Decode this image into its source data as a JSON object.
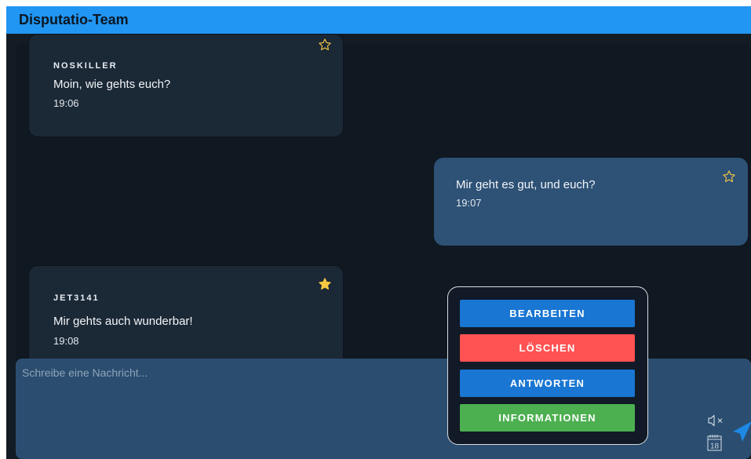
{
  "header": {
    "title": "Disputatio-Team"
  },
  "messages": [
    {
      "username": "NOSKILLER",
      "text": "Moin, wie gehts euch?",
      "time": "19:06",
      "starred": false,
      "own": false
    },
    {
      "username": "",
      "text": "Mir geht es gut, und euch?",
      "time": "19:07",
      "starred": false,
      "own": true
    },
    {
      "username": "JET3141",
      "text": "Mir gehts auch wunderbar!",
      "time": "19:08",
      "starred": true,
      "own": false
    }
  ],
  "composer": {
    "placeholder": "Schreibe eine Nachricht..."
  },
  "context_menu": {
    "edit_label": "BEARBEITEN",
    "delete_label": "LÖSCHEN",
    "reply_label": "ANTWORTEN",
    "info_label": "INFORMATIONEN"
  },
  "icons": {
    "calendar_day": "18",
    "mute": "speaker-mute-icon",
    "send": "send-icon",
    "star": "star-icon"
  },
  "colors": {
    "header": "#2196f3",
    "edit": "#1976d2",
    "delete": "#ff5252",
    "reply": "#1976d2",
    "info": "#4caf50",
    "star_filled": "#f5c842"
  }
}
